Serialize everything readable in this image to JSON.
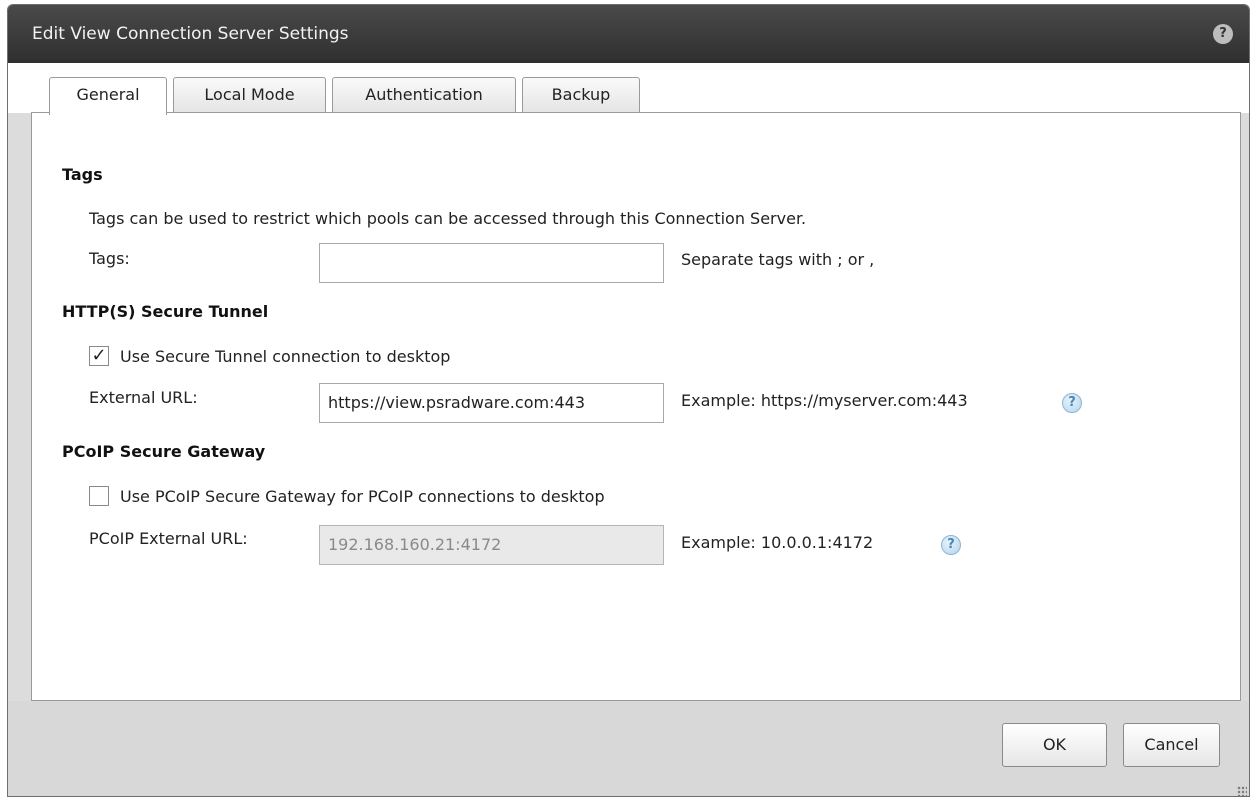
{
  "window": {
    "title": "Edit View Connection Server Settings"
  },
  "tabs": [
    {
      "label": "General",
      "active": true
    },
    {
      "label": "Local Mode",
      "active": false
    },
    {
      "label": "Authentication",
      "active": false
    },
    {
      "label": "Backup",
      "active": false
    }
  ],
  "tags": {
    "heading": "Tags",
    "description": "Tags can be used to restrict which pools can be accessed through this Connection Server.",
    "label": "Tags:",
    "value": "",
    "hint": "Separate tags with ; or ,"
  },
  "tunnel": {
    "heading": "HTTP(S) Secure Tunnel",
    "checkbox_label": "Use Secure Tunnel connection to desktop",
    "checked": true,
    "check_glyph": "✓",
    "url_label": "External URL:",
    "url_value": "https://view.psradware.com:443",
    "example": "Example: https://myserver.com:443"
  },
  "pcoip": {
    "heading": "PCoIP Secure Gateway",
    "checkbox_label": "Use PCoIP Secure Gateway for PCoIP connections to desktop",
    "checked": false,
    "url_label": "PCoIP External URL:",
    "url_value": "192.168.160.21:4172",
    "example": "Example: 10.0.0.1:4172"
  },
  "icons": {
    "help": "?"
  },
  "buttons": {
    "ok": "OK",
    "cancel": "Cancel"
  }
}
